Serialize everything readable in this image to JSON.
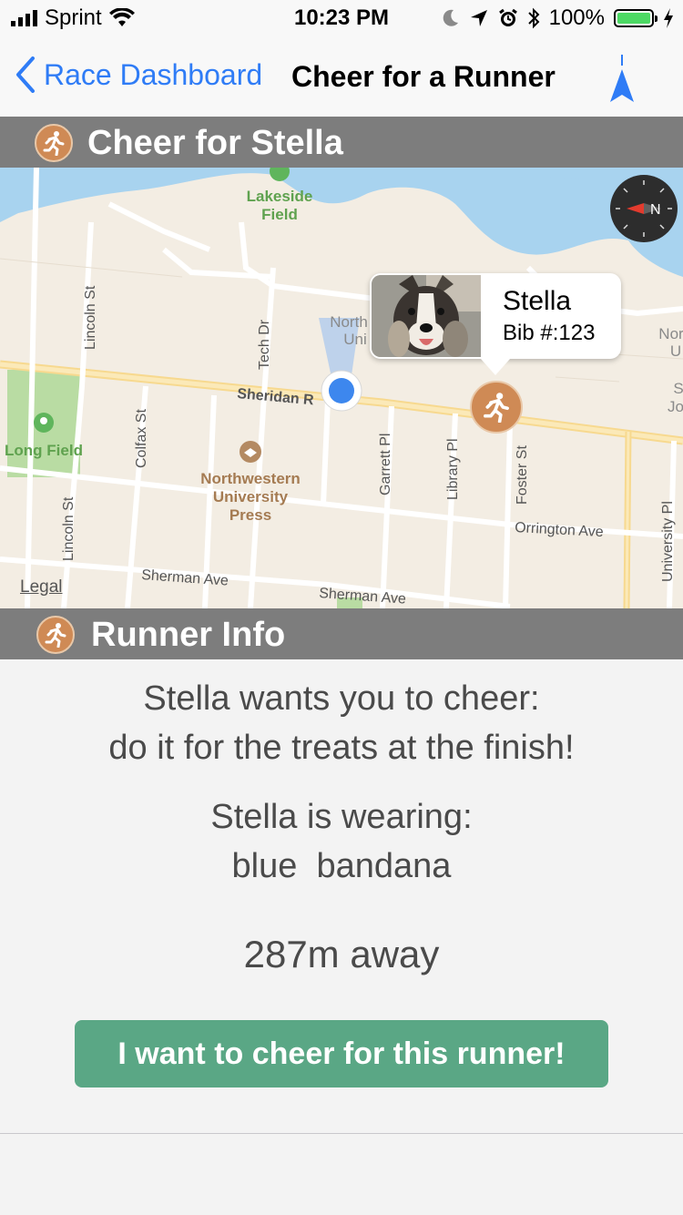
{
  "status_bar": {
    "carrier": "Sprint",
    "time": "10:23 PM",
    "battery": "100%"
  },
  "nav": {
    "back_label": "Race Dashboard",
    "title": "Cheer for a Runner"
  },
  "sections": {
    "cheer_header": "Cheer for Stella",
    "info_header": "Runner Info"
  },
  "map": {
    "callout": {
      "name": "Stella",
      "bib": "Bib #:123"
    },
    "legal": "Legal",
    "labels": {
      "lakeside_1": "Lakeside",
      "lakeside_2": "Field",
      "lincoln_st_top": "Lincoln St",
      "tech_dr": "Tech Dr",
      "north_uni_1": "North",
      "north_uni_2": "Uni",
      "sheridan": "Sheridan R",
      "colfax": "Colfax St",
      "long_field": "Long Field",
      "nu_press_1": "Northwestern",
      "nu_press_2": "University",
      "nu_press_3": "Press",
      "garrett": "Garrett Pl",
      "library": "Library Pl",
      "foster": "Foster St",
      "orrington": "Orrington Ave",
      "lincoln_st_bottom": "Lincoln St",
      "sherman_1": "Sherman Ave",
      "sherman_2": "Sherman Ave",
      "university_pl": "University Pl",
      "nor": "Nor",
      "u": "U",
      "s": "S",
      "jo": "Jo"
    }
  },
  "info": {
    "wants_line1": "Stella wants you to cheer:",
    "wants_line2": "do it for the treats at the finish!",
    "wearing_line1": "Stella is wearing:",
    "wearing_line2": "blue  bandana",
    "distance": "287m away",
    "button_label": "I want to cheer for this runner!"
  },
  "colors": {
    "accent_blue": "#2f7cf6",
    "header_gray": "#7d7d7d",
    "runner_orange": "#cf8a55",
    "button_green": "#5aa785",
    "battery_green": "#4cd964"
  }
}
